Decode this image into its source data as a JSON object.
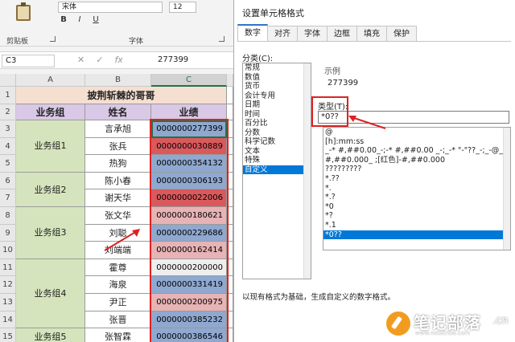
{
  "ribbon": {
    "font_name": "宋体",
    "font_size": "12",
    "bold": "B",
    "italic": "I",
    "underline": "U",
    "clipboard_label": "剪贴板",
    "font_group_label": "字体"
  },
  "formula_bar": {
    "name_box": "C3",
    "cancel": "✕",
    "enter": "✓",
    "fx": "fx",
    "value": "277399"
  },
  "sheet": {
    "columns": [
      "A",
      "B",
      "C"
    ],
    "rows": [
      "1",
      "2",
      "3",
      "4",
      "5",
      "6",
      "7",
      "8",
      "9",
      "10",
      "11",
      "12",
      "13",
      "14",
      "15"
    ],
    "title": "披荆斩棘的哥哥",
    "headers": [
      "业务组",
      "姓名",
      "业绩"
    ],
    "groups": [
      {
        "label": "业务组1",
        "rows": 3
      },
      {
        "label": "业务组2",
        "rows": 2
      },
      {
        "label": "业务组3",
        "rows": 3
      },
      {
        "label": "业务组4",
        "rows": 4
      },
      {
        "label": "业务组5",
        "rows": 1
      }
    ],
    "records": [
      {
        "name": "言承旭",
        "value": "0000000277399",
        "color": "blue"
      },
      {
        "name": "张兵",
        "value": "0000000030889",
        "color": "red"
      },
      {
        "name": "热狗",
        "value": "0000000354132",
        "color": "blue"
      },
      {
        "name": "陈小春",
        "value": "0000000306193",
        "color": "blue"
      },
      {
        "name": "谢天华",
        "value": "0000000022006",
        "color": "red"
      },
      {
        "name": "张文华",
        "value": "0000000180621",
        "color": "pink"
      },
      {
        "name": "刘聪",
        "value": "0000000229686",
        "color": "blue"
      },
      {
        "name": "刘端端",
        "value": "0000000162414",
        "color": "pink"
      },
      {
        "name": "霍尊",
        "value": "0000000200000",
        "color": "white"
      },
      {
        "name": "海泉",
        "value": "0000000331419",
        "color": "blue"
      },
      {
        "name": "尹正",
        "value": "0000000200975",
        "color": "pink"
      },
      {
        "name": "张晋",
        "value": "0000000385232",
        "color": "blue"
      },
      {
        "name": "张智霖",
        "value": "0000000386546",
        "color": "blue"
      }
    ]
  },
  "dialog": {
    "title": "设置单元格格式",
    "tabs": [
      "数字",
      "对齐",
      "字体",
      "边框",
      "填充",
      "保护"
    ],
    "category_label": "分类(C):",
    "categories": [
      "常规",
      "数值",
      "货币",
      "会计专用",
      "日期",
      "时间",
      "百分比",
      "分数",
      "科学记数",
      "文本",
      "特殊",
      "自定义"
    ],
    "selected_category": 11,
    "sample_label": "示例",
    "sample_value": "277399",
    "type_label": "类型(T):",
    "type_value": "*0??",
    "formats": [
      "@",
      "[h]:mm:ss",
      "_-* #,##0.00_-;-* #,##0.00 _-;_-* \"-\"??_-;_-@_-",
      "#,##0.000_ ;[红色]-#,##0.000",
      "?????????",
      "*.??",
      "*.",
      "*.?",
      "*0",
      "*?",
      "*.1",
      "*0??"
    ],
    "selected_format": 11,
    "help_text": "以现有格式为基础，生成自定义的数字格式。"
  },
  "watermark": {
    "text": "笔记部落",
    "url": "www.notetribe.com",
    "suffix": ".cn"
  },
  "colors": {
    "accent": "#0078d7",
    "highlight": "#dd2222",
    "excel_green": "#217346"
  }
}
